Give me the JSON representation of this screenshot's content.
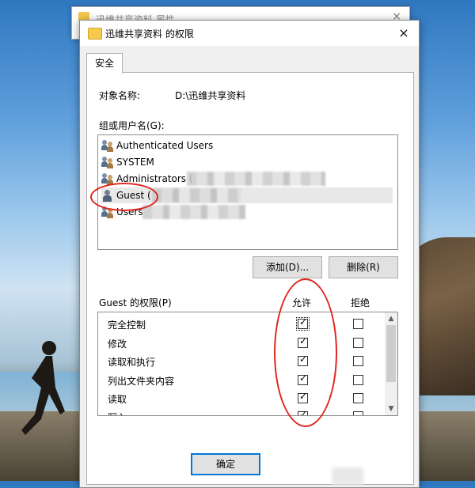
{
  "back_window": {
    "title": "迅维共享资料 属性"
  },
  "dialog": {
    "title": "迅维共享资料 的权限",
    "close_icon": "×",
    "tab_security": "安全",
    "object_label": "对象名称:",
    "object_value": "D:\\迅维共享资料",
    "groups_label": "组或用户名(G):",
    "users": [
      {
        "name": "Authenticated Users",
        "icon": "group-icon"
      },
      {
        "name": "SYSTEM",
        "icon": "group-icon"
      },
      {
        "name": "Administrators (",
        "icon": "group-icon"
      },
      {
        "name": "Guest (",
        "icon": "user-icon",
        "selected": true
      },
      {
        "name": "Users",
        "icon": "group-icon"
      }
    ],
    "add_button": "添加(D)...",
    "remove_button": "删除(R)",
    "permissions_label": "Guest 的权限(P)",
    "allow_header": "允许",
    "deny_header": "拒绝",
    "permissions": [
      {
        "name": "完全控制",
        "allow": true,
        "deny": false
      },
      {
        "name": "修改",
        "allow": true,
        "deny": false
      },
      {
        "name": "读取和执行",
        "allow": true,
        "deny": false
      },
      {
        "name": "列出文件夹内容",
        "allow": true,
        "deny": false
      },
      {
        "name": "读取",
        "allow": true,
        "deny": false
      },
      {
        "name": "写入",
        "allow": true,
        "deny": false
      }
    ],
    "ok_button": "确定",
    "check_mark": "✓",
    "scroll_up": "▲",
    "scroll_down": "▼"
  },
  "colors": {
    "annotation": "#e0261f",
    "accent": "#0078d7"
  }
}
